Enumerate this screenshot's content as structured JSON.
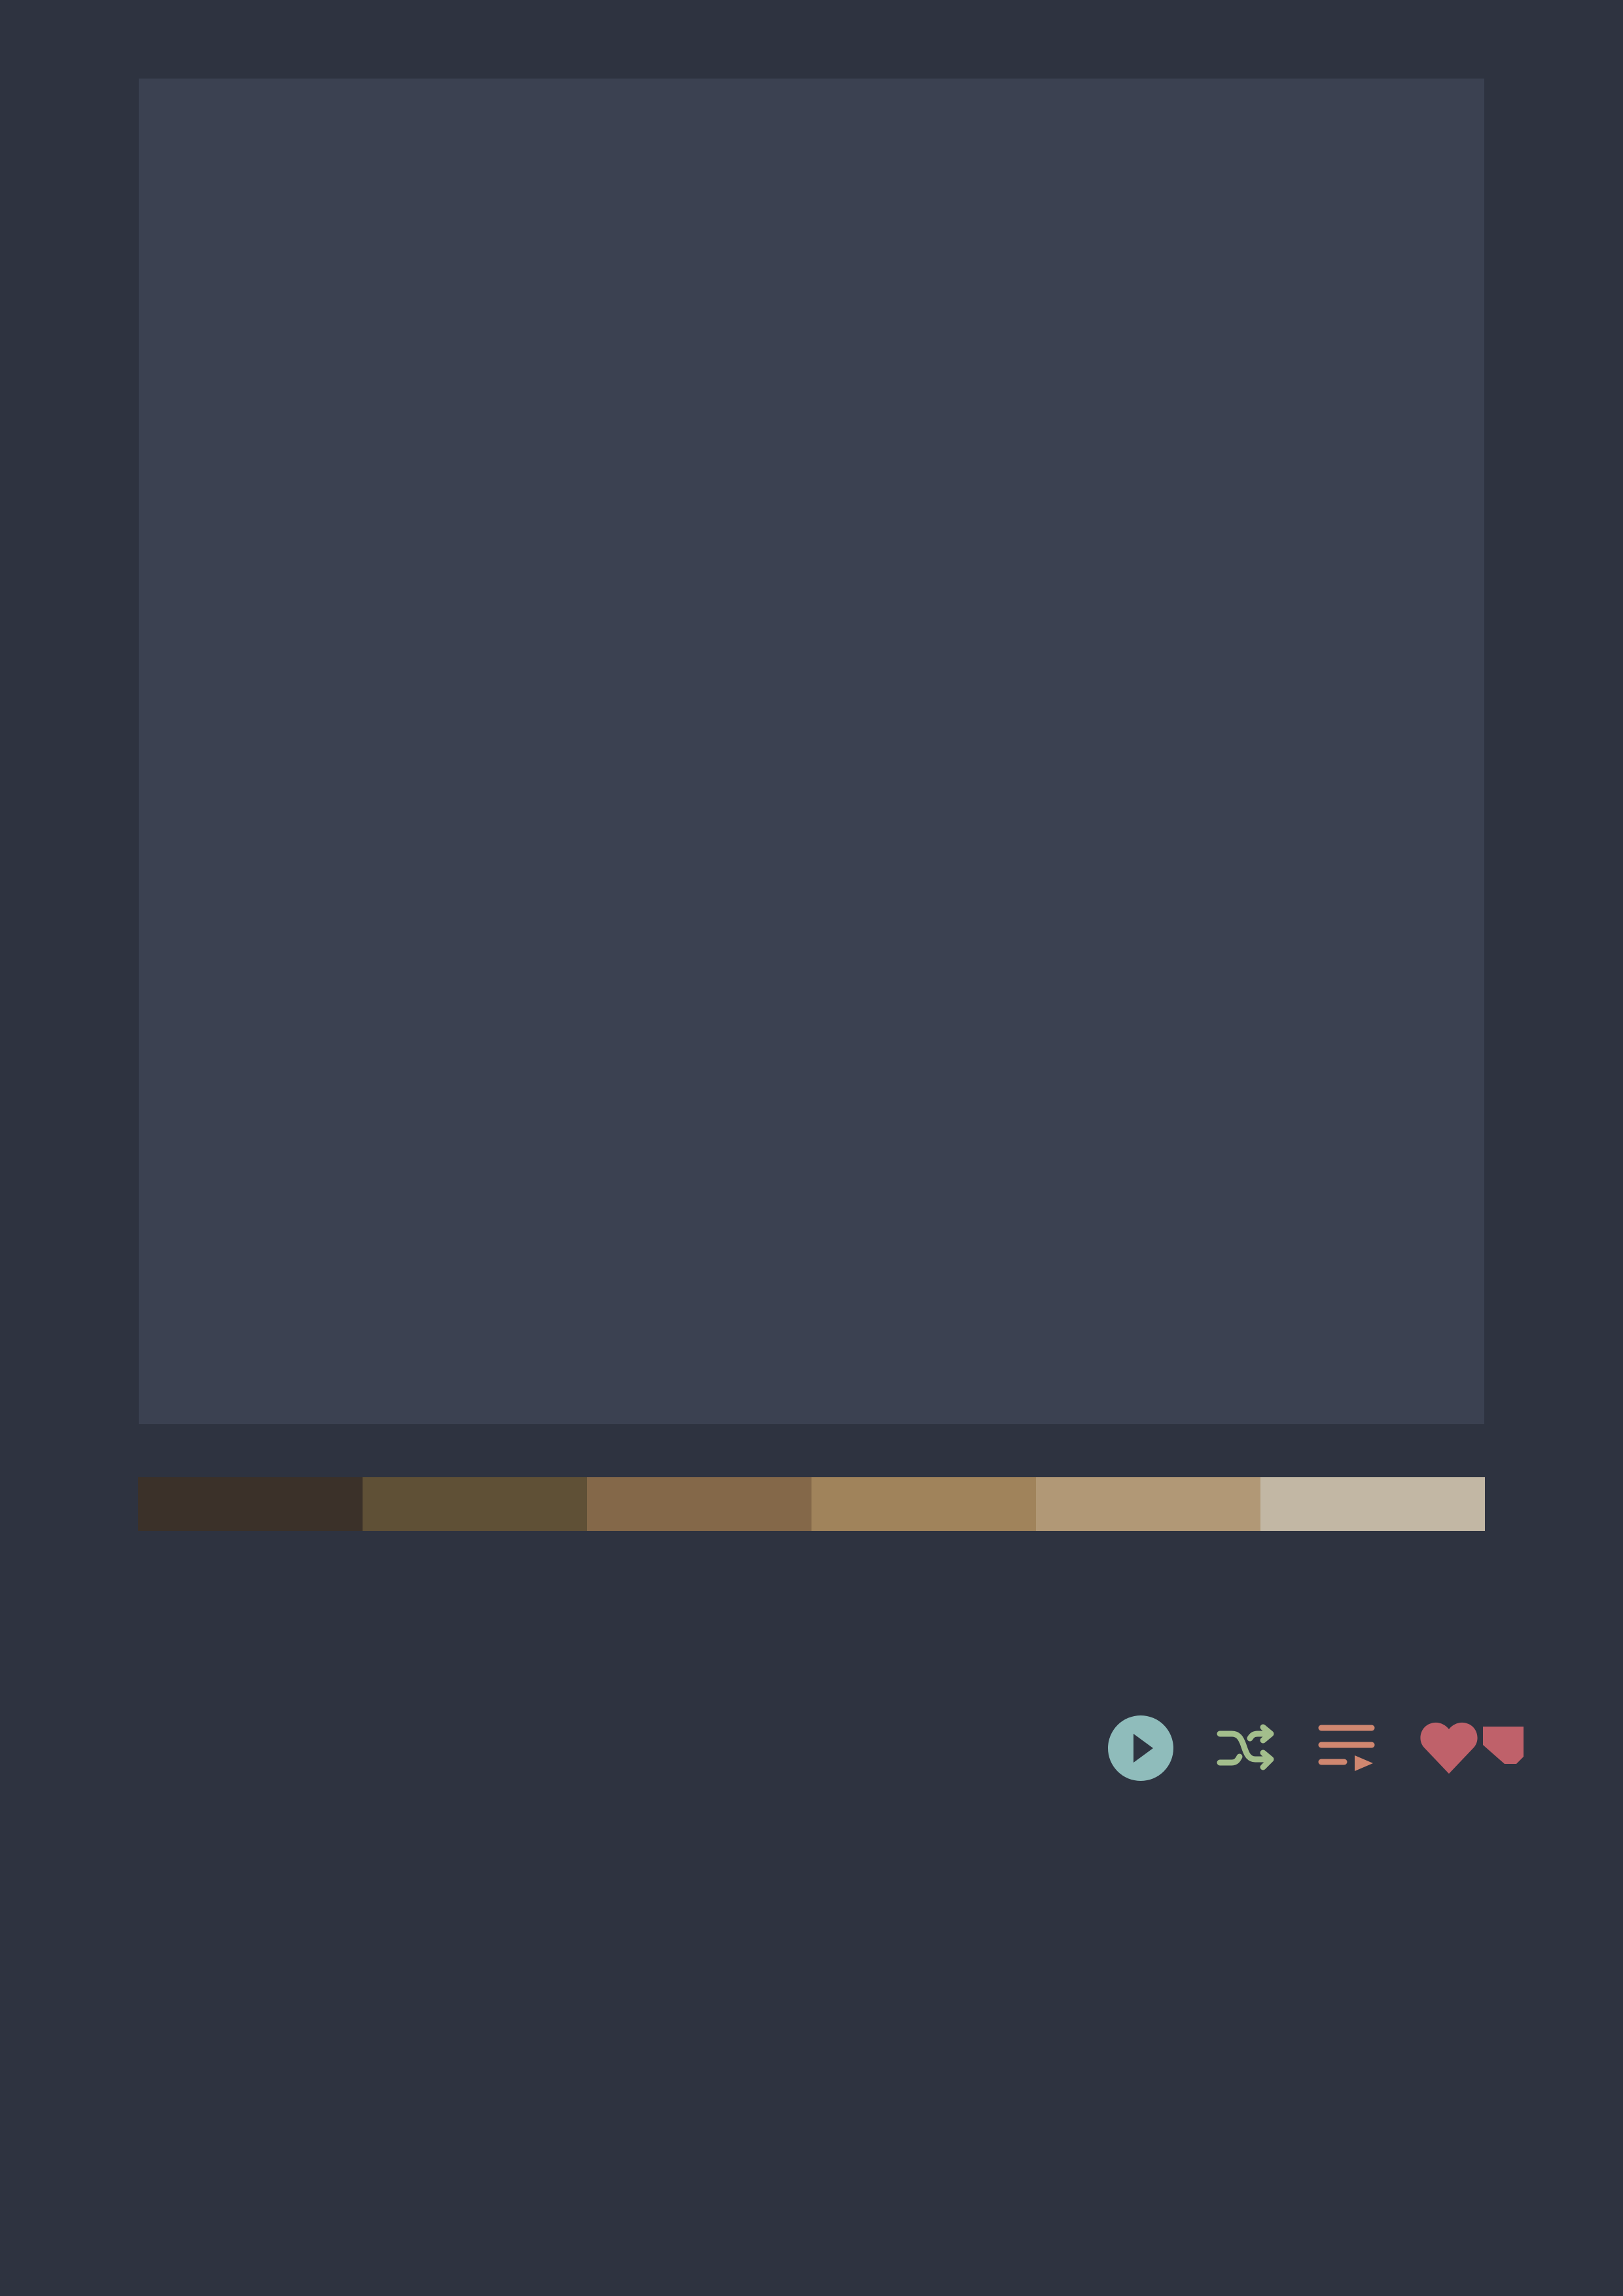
{
  "colors": {
    "background": "#2e3340",
    "artwork": "#3b4151",
    "play": "#8fbcbb",
    "play_glyph": "#2e3340",
    "shuffle": "#a3be8c",
    "queue": "#d08770",
    "like": "#bf616a"
  },
  "palette": {
    "swatches": [
      "#3b3129",
      "#5f5036",
      "#846849",
      "#a0835b",
      "#b19876",
      "#c2b7a4"
    ]
  },
  "controls": {
    "play": {
      "icon": "play-circle-icon"
    },
    "shuffle": {
      "icon": "shuffle-icon"
    },
    "queue": {
      "icon": "queue-list-icon"
    },
    "like": {
      "icon": "heart-icon"
    }
  }
}
